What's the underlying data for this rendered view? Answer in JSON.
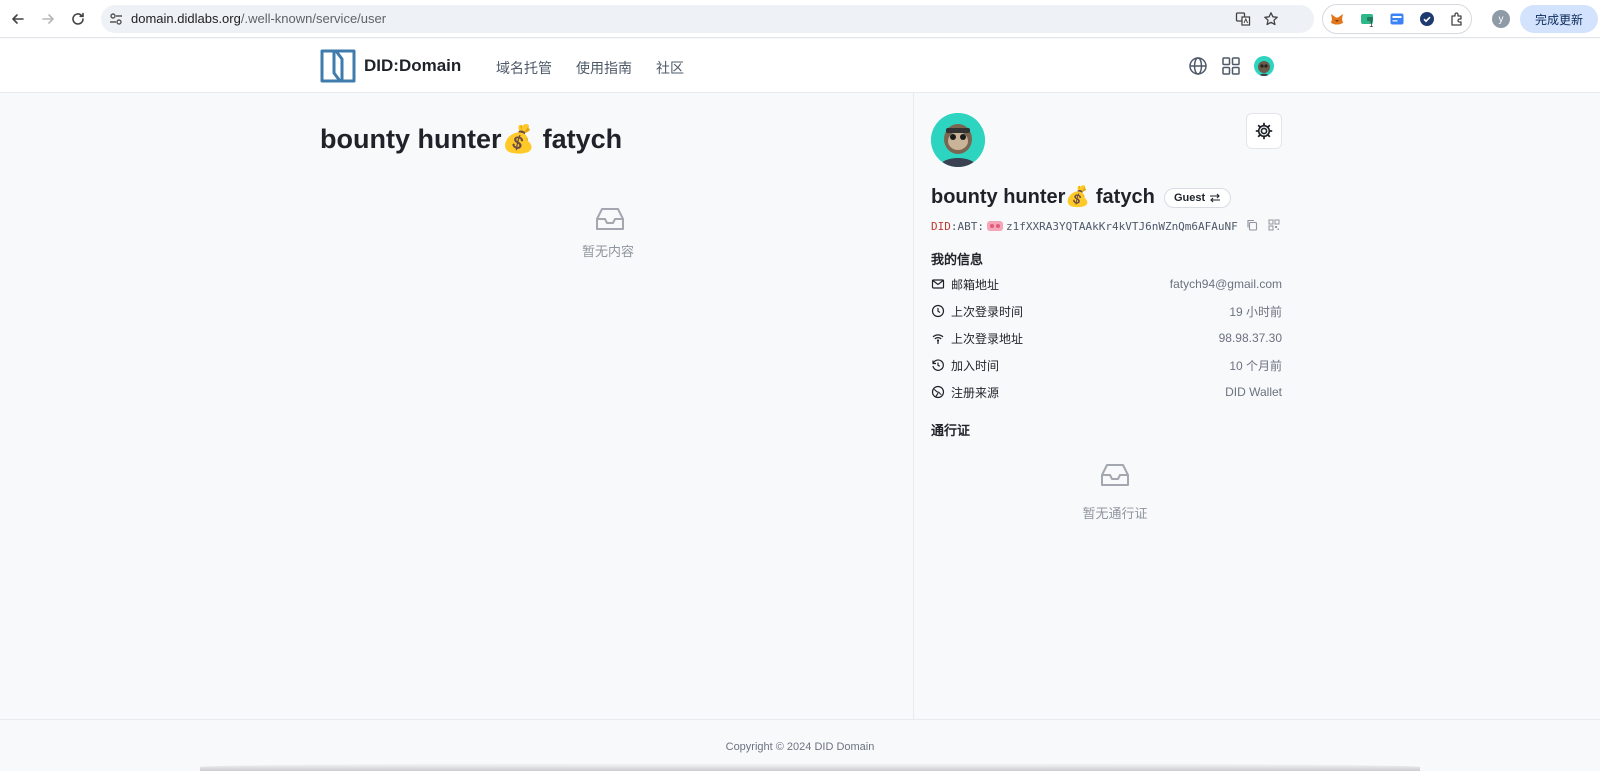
{
  "browser": {
    "url_host": "domain.didlabs.org",
    "url_path": "/.well-known/service/user",
    "profile_initial": "y",
    "update_label": "完成更新",
    "extension_badge": "1"
  },
  "header": {
    "brand": "DID:Domain",
    "nav": [
      "域名托管",
      "使用指南",
      "社区"
    ]
  },
  "main": {
    "title": "bounty hunter💰 fatych",
    "empty_text": "暂无内容"
  },
  "profile": {
    "name": "bounty hunter💰 fatych",
    "badge": "Guest",
    "did_prefix": "DID",
    "did_abt": ":ABT:",
    "did_value": "z1fXXRA3YQTAAkKr4kVTJ6nWZnQm6AFAuNF",
    "my_info_title": "我的信息",
    "info": [
      {
        "icon": "mail-icon",
        "label": "邮箱地址",
        "value": "fatych94@gmail.com"
      },
      {
        "icon": "clock-icon",
        "label": "上次登录时间",
        "value": "19 小时前"
      },
      {
        "icon": "signal-icon",
        "label": "上次登录地址",
        "value": "98.98.37.30"
      },
      {
        "icon": "history-icon",
        "label": "加入时间",
        "value": "10 个月前"
      },
      {
        "icon": "globe-icon",
        "label": "注册来源",
        "value": "DID Wallet"
      }
    ],
    "passport_title": "通行证",
    "passport_empty": "暂无通行证"
  },
  "footer": {
    "copyright": "Copyright © 2024 DID Domain"
  }
}
